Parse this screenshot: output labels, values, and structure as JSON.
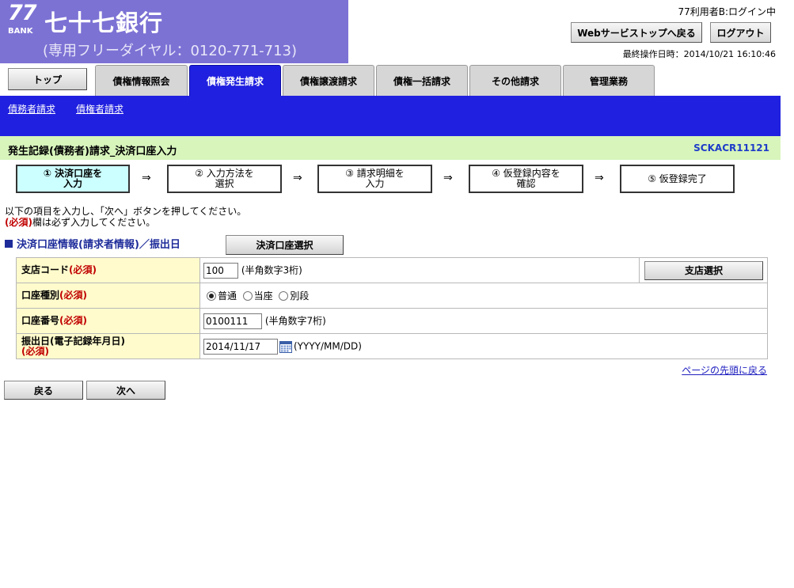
{
  "header": {
    "logo_number": "77",
    "logo_bank": "BANK",
    "bank_name": "七十七銀行",
    "phone": "(専用フリーダイヤル：0120-771-713)",
    "user_status": "77利用者B:ログイン中",
    "web_top_button": "Webサービストップへ戻る",
    "logout_button": "ログアウト",
    "last_operation": "最終操作日時：2014/10/21 16:10:46",
    "brand_color": "#7c72d4"
  },
  "tabs": {
    "top": "トップ",
    "items": [
      "債権情報照会",
      "債権発生請求",
      "債権譲渡請求",
      "債権一括請求",
      "その他請求",
      "管理業務"
    ],
    "active": "債権発生請求",
    "active_color": "#2020e0"
  },
  "subnav": {
    "debtor_request": "債務者請求",
    "creditor_request": "債権者請求"
  },
  "title_bar": {
    "title": "発生記録(債務者)請求_決済口座入力",
    "screen_id": "SCKACR11121"
  },
  "steps": [
    {
      "line1": "① 決済口座を",
      "line2": "入力",
      "current": true
    },
    {
      "line1": "② 入力方法を",
      "line2": "選択",
      "current": false
    },
    {
      "line1": "③ 請求明細を",
      "line2": "入力",
      "current": false
    },
    {
      "line1": "④ 仮登録内容を",
      "line2": "確認",
      "current": false
    },
    {
      "line1": "⑤ 仮登録完了",
      "line2": "",
      "current": false
    }
  ],
  "step_arrow": "⇒",
  "instructions": {
    "line1": "以下の項目を入力し、「次へ」ボタンを押してください。",
    "required_mark": "(必須)",
    "line2_suffix": "欄は必ず入力してください。"
  },
  "section": {
    "title": "決済口座情報(請求者情報)／振出日",
    "account_select_button": "決済口座選択"
  },
  "form": {
    "branch_code": {
      "label": "支店コード",
      "required": "(必須)",
      "value": "100",
      "hint": "(半角数字3桁)",
      "button": "支店選択"
    },
    "account_type": {
      "label": "口座種別",
      "required": "(必須)",
      "options": [
        "普通",
        "当座",
        "別段"
      ],
      "selected": "普通"
    },
    "account_number": {
      "label": "口座番号",
      "required": "(必須)",
      "value": "0100111",
      "hint": "(半角数字7桁)"
    },
    "issue_date": {
      "label": "振出日(電子記録年月日)",
      "required": "(必須)",
      "value": "2014/11/17",
      "hint": "(YYYY/MM/DD)"
    }
  },
  "page_top_link": "ページの先頭に戻る",
  "buttons": {
    "back": "戻る",
    "next": "次へ"
  }
}
